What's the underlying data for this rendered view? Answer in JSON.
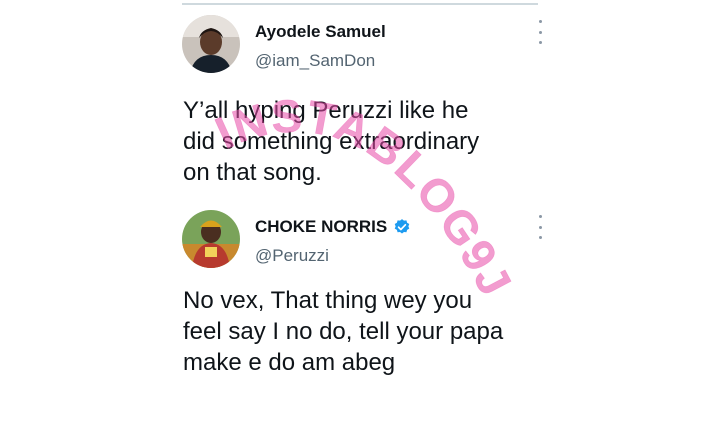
{
  "tweets": [
    {
      "name": "Ayodele Samuel",
      "handle": "@iam_SamDon",
      "text": "Y’all hyping Peruzzi like he\ndid something extraordinary\non that song.",
      "verified": false
    },
    {
      "name": "CHOKE NORRIS",
      "handle": "@Peruzzi",
      "text": "No vex, That thing wey you\nfeel say I no do, tell your papa\nmake e do am abeg",
      "verified": true
    }
  ],
  "watermark": {
    "text": "INSTABLOG9JA",
    "color": "#e84aa8"
  },
  "colors": {
    "text": "#0f1419",
    "secondary": "#536471",
    "verified_blue": "#1d9bf0"
  },
  "icons": [
    "more-icon",
    "verified-badge-icon"
  ]
}
